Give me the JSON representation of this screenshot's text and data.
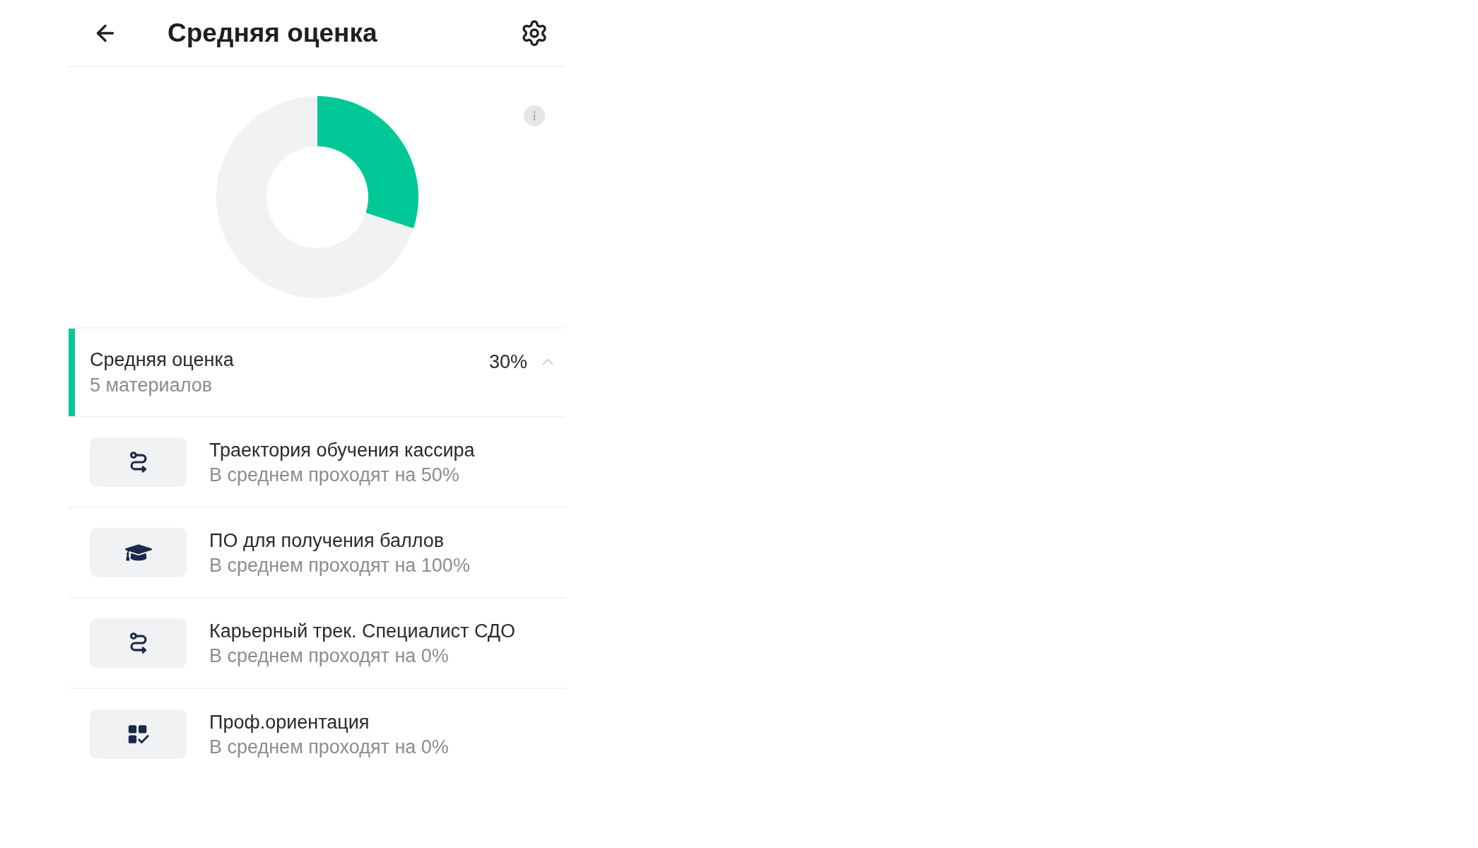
{
  "header": {
    "title": "Средняя оценка"
  },
  "overview": {
    "chart_data": {
      "type": "donut",
      "values": [
        30,
        70
      ]
    }
  },
  "summary": {
    "title": "Средняя оценка",
    "subtitle": "5 материалов",
    "value": "30%",
    "expanded": true
  },
  "materials": [
    {
      "kind": "trajectory",
      "title": "Траектория обучения кассира",
      "subtitle": "В среднем проходят на 50%"
    },
    {
      "kind": "course",
      "title": "ПО для получения баллов",
      "subtitle": "В среднем проходят на 100%"
    },
    {
      "kind": "trajectory",
      "title": "Карьерный трек. Специалист СДО",
      "subtitle": "В среднем проходят на 0%"
    },
    {
      "kind": "test",
      "title": "Проф.ориентация",
      "subtitle": "В среднем проходят на 0%"
    }
  ]
}
